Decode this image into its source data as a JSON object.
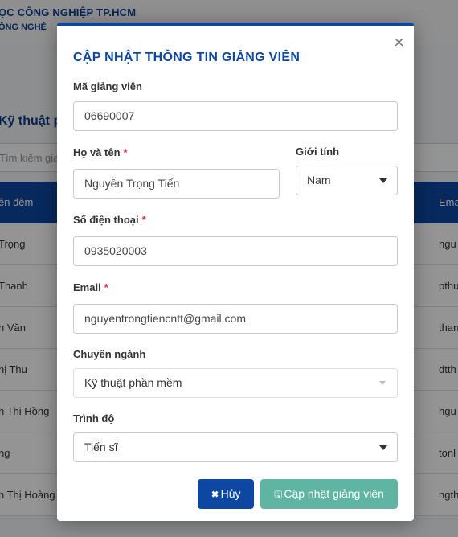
{
  "background": {
    "header_line1": "ỌC CÔNG NGHIỆP TP.HCM",
    "header_line2": "ÔNG NGHỆ",
    "section_title": "Kỹ thuật p",
    "search_placeholder": "Tìm kiếm gia",
    "table_headers": [
      "ên đệm",
      "Ema"
    ],
    "rows": [
      [
        "Trọng",
        "ngu"
      ],
      [
        "Thanh",
        "pthu"
      ],
      [
        "n Văn",
        "than"
      ],
      [
        "hị Thu",
        "dtth"
      ],
      [
        "n Thị Hồng",
        "ngu"
      ],
      [
        "ng",
        "tonl"
      ],
      [
        "n Thị Hoàng",
        "ngth"
      ]
    ]
  },
  "modal": {
    "close_label": "×",
    "title": "CẬP NHẬT THÔNG TIN GIẢNG VIÊN",
    "fields": {
      "ma_gv": {
        "label": "Mã giảng viên",
        "value": "06690007"
      },
      "ho_ten": {
        "label": "Họ và tên",
        "required": "*",
        "value": "Nguyễn Trọng Tiến"
      },
      "gioi_tinh": {
        "label": "Giới tính",
        "value": "Nam"
      },
      "sdt": {
        "label": "Số điện thoại",
        "required": "*",
        "value": "0935020003"
      },
      "email": {
        "label": "Email",
        "required": "*",
        "value": "nguyentrongtiencntt@gmail.com"
      },
      "chuyen_nganh": {
        "label": "Chuyên ngành",
        "value": "Kỹ thuật phần mềm"
      },
      "trinh_do": {
        "label": "Trình độ",
        "value": "Tiến sĩ"
      }
    },
    "buttons": {
      "cancel_icon": "✖",
      "cancel_label": "Hủy",
      "save_icon": "🖫",
      "save_label": "Cập nhật giảng viên"
    },
    "colors": {
      "primary": "#0d47a1",
      "save": "#5fb4a2",
      "required": "#d32f2f"
    }
  }
}
